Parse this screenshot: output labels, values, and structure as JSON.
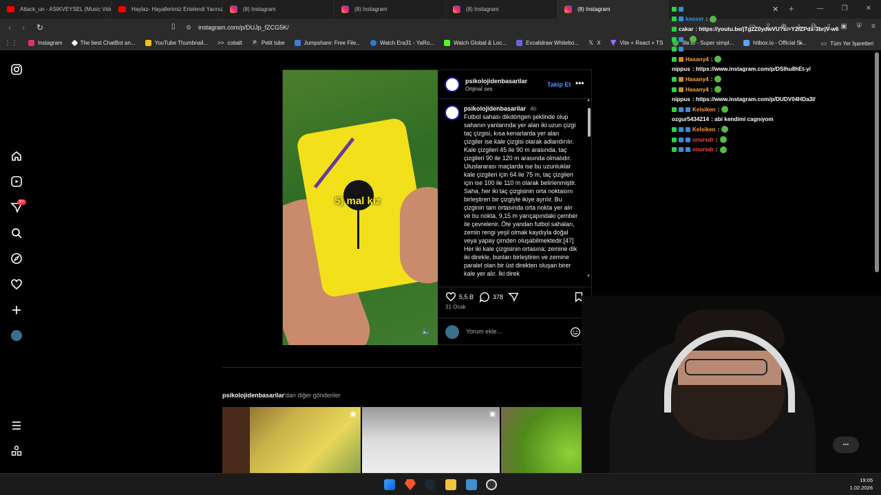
{
  "browser": {
    "tabs": [
      {
        "label": "Attack_un - ASIKVEYSEL (Music Video)",
        "type": "yt"
      },
      {
        "label": "Haylaz- Hayallerimiz Ertelendi Yarınız",
        "type": "yt"
      },
      {
        "label": "(8) Instagram",
        "type": "ig"
      },
      {
        "label": "(8) Instagram",
        "type": "ig"
      },
      {
        "label": "(8) Instagram",
        "type": "ig"
      },
      {
        "label": "(8) Instagram",
        "type": "ig"
      }
    ],
    "url": "instagram.com/p/DUJp_fZCG5K/",
    "bookmarks": [
      {
        "label": "Instagram",
        "color": "#e1306c"
      },
      {
        "label": "The best ChatBot an...",
        "color": "#ffffff"
      },
      {
        "label": "YouTube Thumbnail...",
        "color": "#f4c20d"
      },
      {
        "label": "cobalt",
        "color": "#ffffff"
      },
      {
        "label": "Petit tube",
        "color": "#222222"
      },
      {
        "label": "Jumpshare: Free File...",
        "color": "#3b7ddd"
      },
      {
        "label": "Watch Era31 - YaRo...",
        "color": "#2b7bd8"
      },
      {
        "label": "Watch Global & Loc...",
        "color": "#53fc18"
      },
      {
        "label": "Excalidraw Whitebo...",
        "color": "#6965db"
      },
      {
        "label": "X",
        "color": "#ffffff"
      },
      {
        "label": "Vite + React + TS",
        "color": "#9e67ff"
      },
      {
        "label": "file.io - Super simpl...",
        "color": "#3bb54a"
      },
      {
        "label": "hitbox.io - Official Si...",
        "color": "#5aa0ff"
      }
    ],
    "all_bookmarks": "Tüm Yer İşaretleri"
  },
  "post": {
    "username": "psikolojidenbasarilar",
    "audio": "Orijinal ses",
    "follow": "Takip Et",
    "comment_user": "psikolojidenbasarilar",
    "comment_time": "4h",
    "caption_overlay": "5) mal kız",
    "caption": "Futbol sahası dikdörtgen şeklinde olup sahanın yanlarında yer alan iki uzun çizgi taç çizgisi, kısa kenarlarda yer alan çizgiler ise kale çizgisi olarak adlandırılır. Kale çizgileri 45 ile 90 m arasında, taç çizgileri 90 ile 120 m arasında olmalıdır. Uluslararası maçlarda ise bu uzunluklar kale çizgileri için 64 ile 75 m, taç çizgileri için ise 100 ile 110 m olarak belirlenmiştir. Saha, her iki taç çizgisinin orta noktasını birleştiren bir çizgiyle ikiye ayrılır. Bu çizginin tam ortasında orta nokta yer alır ve bu nokta, 9,15 m yarıçapındaki çember ile çevrelenir. Öte yandan futbol sahaları, zemin rengi yeşil olmak kaydıyla doğal veya yapay çimden oluşabilmektedir.[47]\nHer iki kale çizgisinin ortasına; zemine dik iki direkle, bunları birleştiren ve zemine paralel olan bir üst direkten oluşan birer kale yer alır. İki direk",
    "likes": "5,5 B",
    "comments": "378",
    "date": "31 Ocak",
    "comment_placeholder": "Yorum ekle..."
  },
  "more_posts": {
    "user": "psikolojidenbasarilar",
    "suffix": "'dan diğer gönderiler"
  },
  "chat": [
    {
      "user": "",
      "msg": "",
      "color": "#ffffff"
    },
    {
      "user": "kaosxr",
      "msg": ":",
      "color": "#3a8bd9"
    },
    {
      "user": "cakar",
      "msg": ": https://youtu.be/jTg2Z0ydwVU?si=Y2fZPdx-3brjV-w6",
      "color": "#ffffff"
    },
    {
      "user": "",
      "msg": "",
      "color": "#ff4444"
    },
    {
      "user": "",
      "msg": "",
      "color": "#ff4444"
    },
    {
      "user": "Hasany4",
      "msg": ":",
      "color": "#ffaa44"
    },
    {
      "user": "nippus",
      "msg": ": https://www.instagram.com/p/DSIhu8hEt-y/",
      "color": "#ffffff"
    },
    {
      "user": "Hasany4",
      "msg": ":",
      "color": "#ffaa44"
    },
    {
      "user": "Hasany4",
      "msg": ":",
      "color": "#ffaa44"
    },
    {
      "user": "nippus",
      "msg": ": https://www.instagram.com/p/DUDV04HDa3I/",
      "color": "#ffffff"
    },
    {
      "user": "Kelsiken",
      "msg": ":",
      "color": "#ff9a3c"
    },
    {
      "user": "ozgur5434214",
      "msg": ": abi kendimi cagnıyom",
      "color": "#ffffff"
    },
    {
      "user": "Kelsiken",
      "msg": ":",
      "color": "#ff9a3c"
    },
    {
      "user": "onursdr",
      "msg": ":",
      "color": "#ff4444"
    },
    {
      "user": "onursdr",
      "msg": ":",
      "color": "#ff4444"
    }
  ],
  "clock": {
    "time": "19:05",
    "date": "1.02.2026"
  }
}
